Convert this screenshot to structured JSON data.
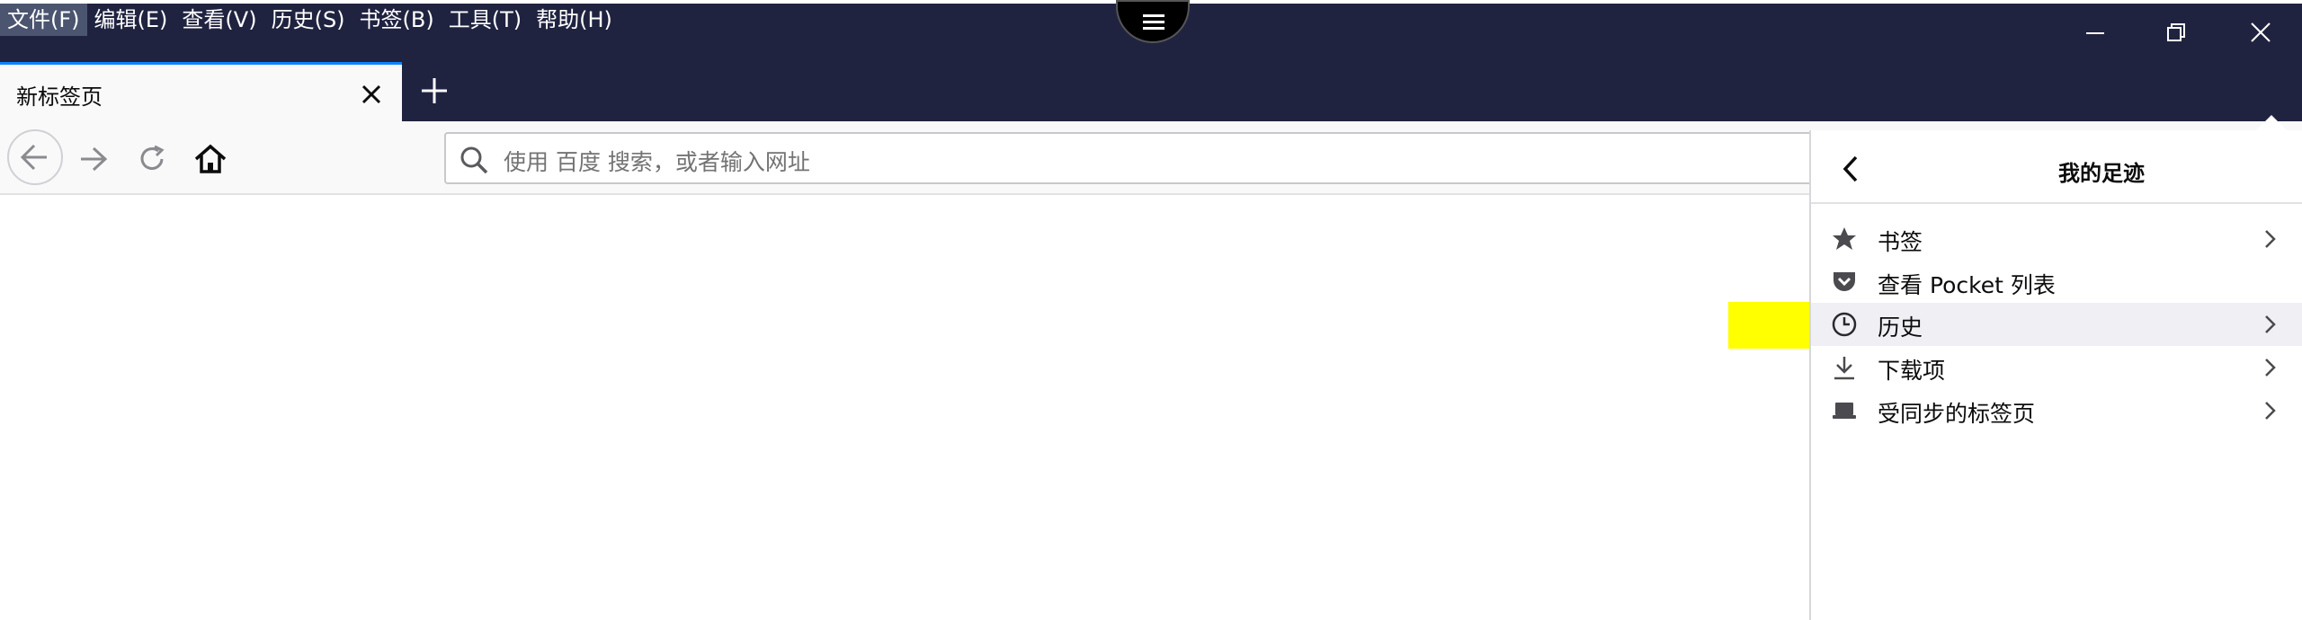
{
  "menubar": {
    "items": [
      {
        "label": "文件(F)"
      },
      {
        "label": "编辑(E)"
      },
      {
        "label": "查看(V)"
      },
      {
        "label": "历史(S)"
      },
      {
        "label": "书签(B)"
      },
      {
        "label": "工具(T)"
      },
      {
        "label": "帮助(H)"
      }
    ]
  },
  "tab": {
    "title": "新标签页"
  },
  "urlbar": {
    "placeholder": "使用 百度 搜索，或者输入网址"
  },
  "panel": {
    "title": "我的足迹",
    "items": [
      {
        "label": "书签",
        "icon": "star-icon",
        "has_submenu": true
      },
      {
        "label": "查看 Pocket 列表",
        "icon": "pocket-icon",
        "has_submenu": false
      },
      {
        "label": "历史",
        "icon": "clock-icon",
        "has_submenu": true
      },
      {
        "label": "下载项",
        "icon": "download-icon",
        "has_submenu": true
      },
      {
        "label": "受同步的标签页",
        "icon": "laptop-icon",
        "has_submenu": true
      }
    ]
  },
  "colors": {
    "titlebar_bg": "#202340",
    "tab_accent": "#0a84ff",
    "highlight": "#ffff00",
    "active_row": "#f0f0f4"
  }
}
